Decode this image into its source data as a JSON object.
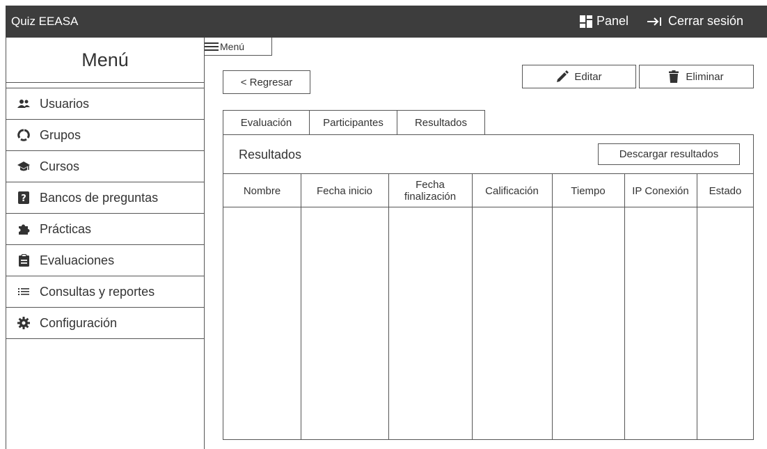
{
  "topbar": {
    "app_title": "Quiz EEASA",
    "panel_label": "Panel",
    "logout_label": "Cerrar sesión"
  },
  "sidebar": {
    "title": "Menú",
    "items": [
      {
        "label": "Usuarios",
        "icon": "users-icon"
      },
      {
        "label": "Grupos",
        "icon": "groups-icon"
      },
      {
        "label": "Cursos",
        "icon": "graduation-cap-icon"
      },
      {
        "label": "Bancos de preguntas",
        "icon": "question-icon"
      },
      {
        "label": "Prácticas",
        "icon": "puzzle-icon"
      },
      {
        "label": "Evaluaciones",
        "icon": "clipboard-icon"
      },
      {
        "label": "Consultas y reportes",
        "icon": "list-icon"
      },
      {
        "label": "Configuración",
        "icon": "gear-icon"
      }
    ]
  },
  "menu_toggle": {
    "label": "Menú"
  },
  "actions": {
    "back_label": "< Regresar",
    "edit_label": "Editar",
    "delete_label": "Eliminar"
  },
  "tabs": [
    {
      "label": "Evaluación"
    },
    {
      "label": "Participantes"
    },
    {
      "label": "Resultados"
    }
  ],
  "results": {
    "title": "Resultados",
    "download_label": "Descargar resultados",
    "columns": [
      {
        "label": "Nombre"
      },
      {
        "label": "Fecha inicio"
      },
      {
        "label": "Fecha finalización"
      },
      {
        "label": "Calificación"
      },
      {
        "label": "Tiempo"
      },
      {
        "label": "IP Conexión"
      },
      {
        "label": "Estado"
      }
    ],
    "rows": []
  },
  "colors": {
    "topbar_bg": "#3d3d3d",
    "border": "#555555",
    "text": "#333333"
  }
}
